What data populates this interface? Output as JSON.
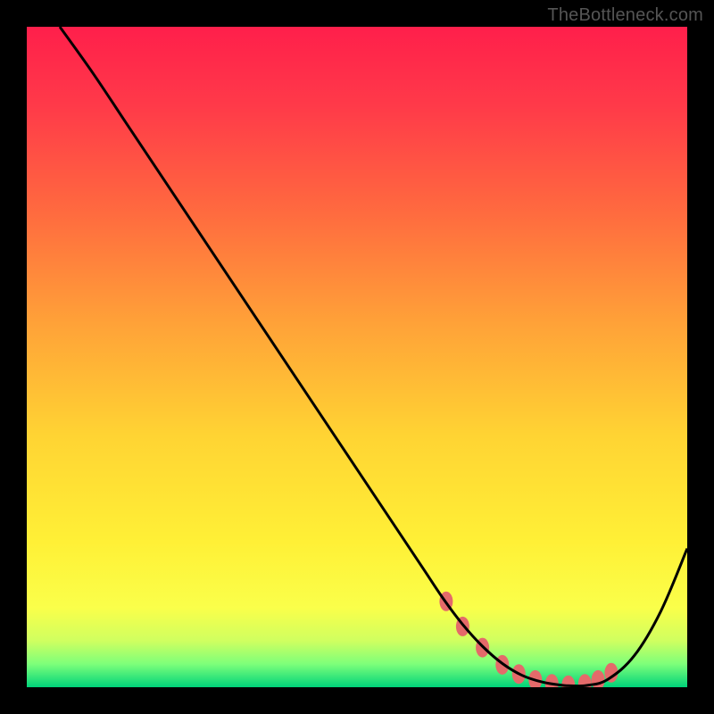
{
  "watermark": "TheBottleneck.com",
  "chart_data": {
    "type": "line",
    "title": "",
    "xlabel": "",
    "ylabel": "",
    "xlim": [
      0,
      100
    ],
    "ylim": [
      0,
      100
    ],
    "gradient_stops": [
      {
        "offset": 0.0,
        "color": "#ff1f4b"
      },
      {
        "offset": 0.12,
        "color": "#ff3a49"
      },
      {
        "offset": 0.28,
        "color": "#ff6a3f"
      },
      {
        "offset": 0.45,
        "color": "#ffa238"
      },
      {
        "offset": 0.62,
        "color": "#ffd433"
      },
      {
        "offset": 0.78,
        "color": "#fff036"
      },
      {
        "offset": 0.88,
        "color": "#faff4a"
      },
      {
        "offset": 0.93,
        "color": "#cfff60"
      },
      {
        "offset": 0.965,
        "color": "#7dff7a"
      },
      {
        "offset": 1.0,
        "color": "#00d37a"
      }
    ],
    "series": [
      {
        "name": "bottleneck-curve",
        "stroke": "#000000",
        "x": [
          5,
          10,
          15,
          20,
          25,
          30,
          35,
          40,
          45,
          50,
          55,
          60,
          63,
          66,
          69,
          72,
          75,
          78,
          81,
          83,
          85,
          88,
          92,
          96,
          100
        ],
        "y": [
          100,
          93,
          85.5,
          78,
          70.5,
          63,
          55.5,
          48,
          40.5,
          33,
          25.5,
          18,
          13.5,
          9.5,
          6.2,
          3.6,
          1.8,
          0.8,
          0.3,
          0.2,
          0.3,
          1.2,
          4.8,
          11.5,
          21
        ]
      }
    ],
    "markers": {
      "name": "optimal-region-dots",
      "color": "#e46a6a",
      "x": [
        63.5,
        66,
        69,
        72,
        74.5,
        77,
        79.5,
        82,
        84.5,
        86.5,
        88.5
      ],
      "y": [
        13.0,
        9.2,
        6.0,
        3.4,
        2.0,
        1.1,
        0.5,
        0.3,
        0.5,
        1.1,
        2.2
      ]
    }
  }
}
